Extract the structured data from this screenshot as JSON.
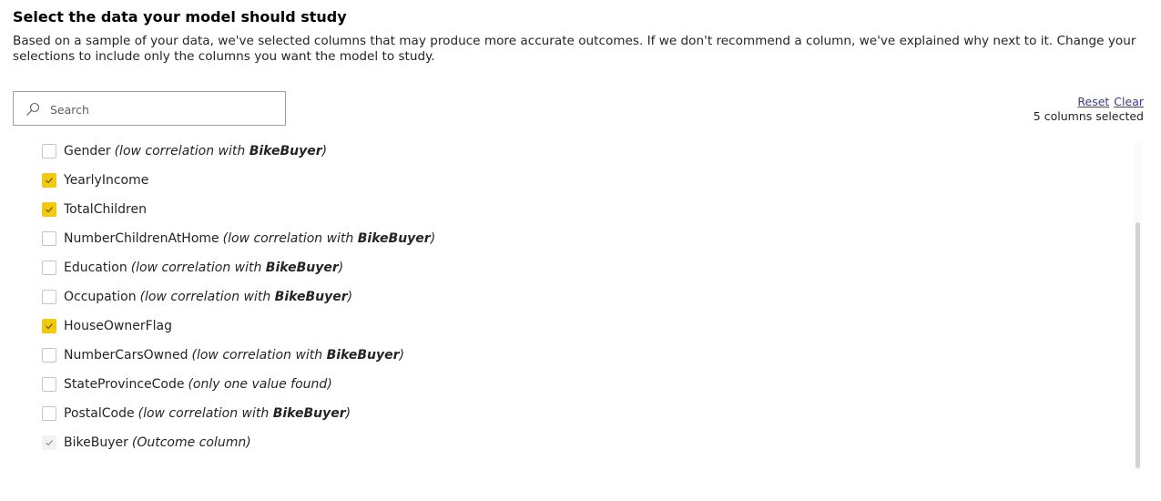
{
  "header": {
    "title": "Select the data your model should study",
    "description": "Based on a sample of your data, we've selected columns that may produce more accurate outcomes. If we don't recommend a column, we've explained why next to it. Change your selections to include only the columns you want the model to study."
  },
  "search": {
    "placeholder": "Search",
    "value": ""
  },
  "actions": {
    "reset_label": "Reset",
    "clear_label": "Clear",
    "selected_count": "5 columns selected"
  },
  "colors": {
    "accent": "#f2c811"
  },
  "columns": [
    {
      "name": "Gender",
      "checked": false,
      "note_prefix": "(low correlation with ",
      "note_bold": "BikeBuyer",
      "note_suffix": ")"
    },
    {
      "name": "YearlyIncome",
      "checked": true
    },
    {
      "name": "TotalChildren",
      "checked": true
    },
    {
      "name": "NumberChildrenAtHome",
      "checked": false,
      "note_prefix": "(low correlation with ",
      "note_bold": "BikeBuyer",
      "note_suffix": ")"
    },
    {
      "name": "Education",
      "checked": false,
      "note_prefix": "(low correlation with ",
      "note_bold": "BikeBuyer",
      "note_suffix": ")"
    },
    {
      "name": "Occupation",
      "checked": false,
      "note_prefix": "(low correlation with ",
      "note_bold": "BikeBuyer",
      "note_suffix": ")"
    },
    {
      "name": "HouseOwnerFlag",
      "checked": true
    },
    {
      "name": "NumberCarsOwned",
      "checked": false,
      "note_prefix": "(low correlation with ",
      "note_bold": "BikeBuyer",
      "note_suffix": ")"
    },
    {
      "name": "StateProvinceCode",
      "checked": false,
      "note_prefix": "(only one value found)"
    },
    {
      "name": "PostalCode",
      "checked": false,
      "note_prefix": "(low correlation with ",
      "note_bold": "BikeBuyer",
      "note_suffix": ")"
    },
    {
      "name": "BikeBuyer",
      "checked": true,
      "disabled": true,
      "note_prefix": "(Outcome column)"
    }
  ]
}
